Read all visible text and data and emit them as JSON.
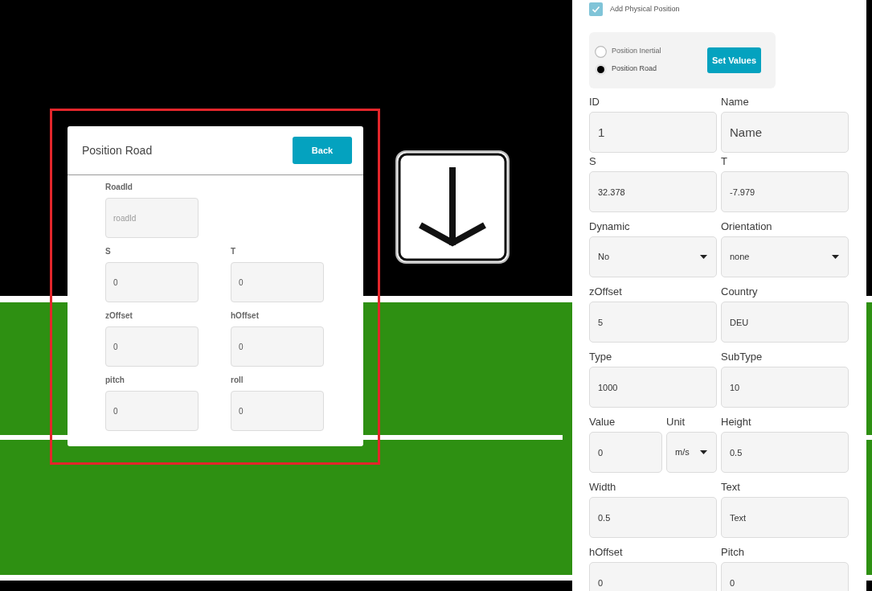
{
  "dialog": {
    "title": "Position Road",
    "back_button": "Back",
    "rows": [
      {
        "fields": [
          {
            "label": "RoadId",
            "placeholder": "roadId"
          }
        ]
      },
      {
        "fields": [
          {
            "label": "S",
            "value": "0"
          },
          {
            "label": "T",
            "value": "0"
          }
        ]
      },
      {
        "fields": [
          {
            "label": "zOffset",
            "value": "0"
          },
          {
            "label": "hOffset",
            "value": "0"
          }
        ]
      },
      {
        "fields": [
          {
            "label": "pitch",
            "value": "0"
          },
          {
            "label": "roll",
            "value": "0"
          }
        ]
      }
    ]
  },
  "panel": {
    "add_physical_position": {
      "label": "Add Physical Position",
      "checked": true
    },
    "position_type": {
      "options": [
        {
          "label": "Position Inertial",
          "selected": false
        },
        {
          "label": "Position Road",
          "selected": true
        }
      ],
      "set_values_button": "Set Values"
    },
    "rows": [
      {
        "fields": [
          {
            "label": "ID",
            "value": "1",
            "kind": "large"
          },
          {
            "label": "Name",
            "value": "Name",
            "kind": "large"
          }
        ]
      },
      {
        "fields": [
          {
            "label": "S",
            "value": "32.378",
            "kind": "text"
          },
          {
            "label": "T",
            "value": "-7.979",
            "kind": "text"
          }
        ]
      },
      {
        "fields": [
          {
            "label": "Dynamic",
            "value": "No",
            "kind": "select"
          },
          {
            "label": "Orientation",
            "value": "none",
            "kind": "select"
          }
        ]
      },
      {
        "fields": [
          {
            "label": "zOffset",
            "value": "5",
            "kind": "text"
          },
          {
            "label": "Country",
            "value": "DEU",
            "kind": "text"
          }
        ]
      },
      {
        "fields": [
          {
            "label": "Type",
            "value": "1000",
            "kind": "text"
          },
          {
            "label": "SubType",
            "value": "10",
            "kind": "text"
          }
        ]
      },
      {
        "fields": [
          {
            "label": "Value",
            "value": "0",
            "kind": "text"
          },
          {
            "label": "Unit",
            "value": "m/s",
            "kind": "select"
          },
          {
            "label": "Height",
            "value": "0.5",
            "kind": "text"
          }
        ]
      },
      {
        "fields": [
          {
            "label": "Width",
            "value": "0.5",
            "kind": "text"
          },
          {
            "label": "Text",
            "value": "Text",
            "kind": "text"
          }
        ]
      },
      {
        "fields": [
          {
            "label": "hOffset",
            "value": "0",
            "kind": "text"
          },
          {
            "label": "Pitch",
            "value": "0",
            "kind": "text"
          }
        ]
      }
    ]
  }
}
